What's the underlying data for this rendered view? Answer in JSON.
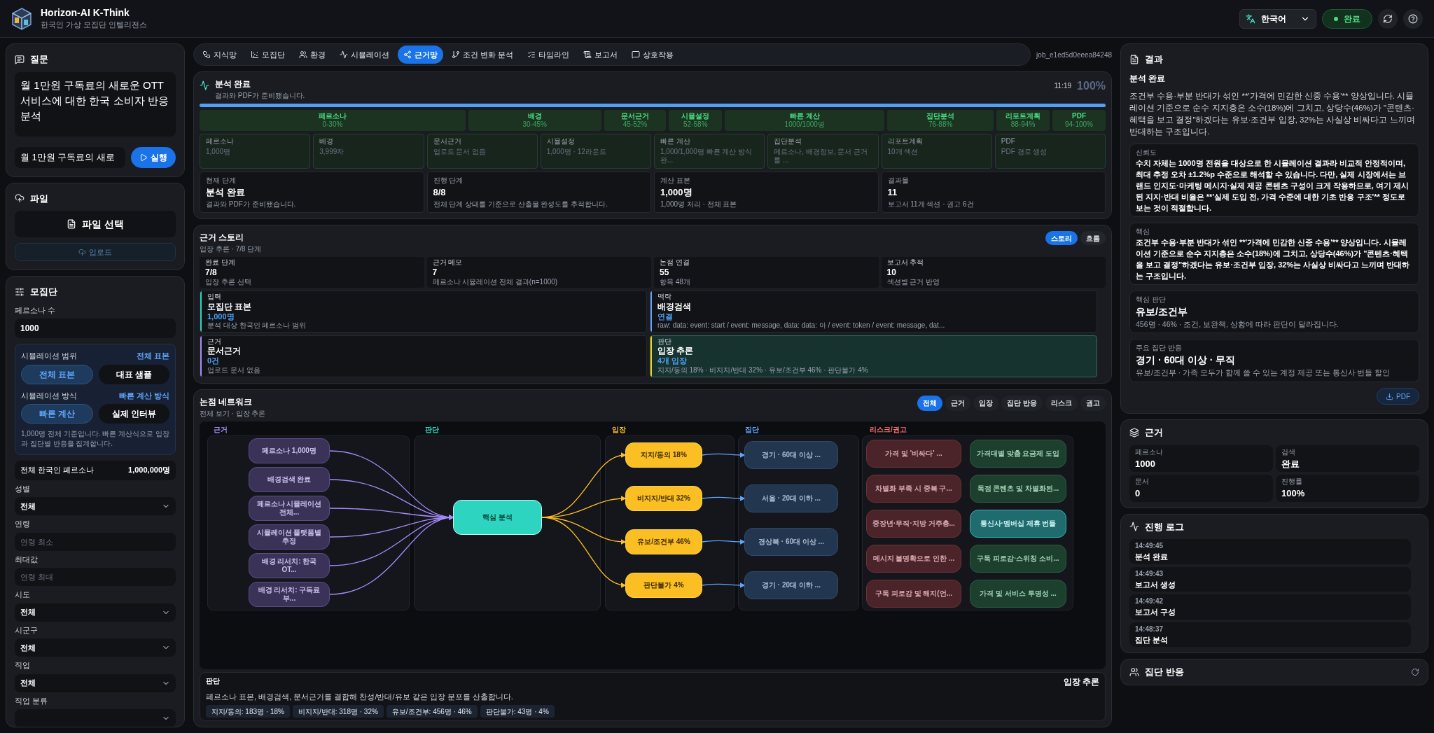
{
  "app": {
    "title": "Horizon-AI K-Think",
    "subtitle": "한국인 가상 모집단 인텔리전스"
  },
  "header": {
    "language": "한국어",
    "status": "완료"
  },
  "question": {
    "title": "질문",
    "text": "월 1만원 구독료의 새로운 OTT 서비스에 대한 한국 소비자 반응 분석",
    "input_value": "월 1만원 구독료의 새로",
    "run_label": "실행"
  },
  "file": {
    "title": "파일",
    "select_label": "파일 선택",
    "upload_label": "업로드",
    "upload_disabled": true
  },
  "population": {
    "title": "모집단",
    "count_label": "페르소나 수",
    "count_value": "1000",
    "scope": {
      "label": "시뮬레이션 범위",
      "value": "전체 표본",
      "options": [
        {
          "label": "전체 표본",
          "selected": true
        },
        {
          "label": "대표 샘플",
          "selected": false
        }
      ]
    },
    "method": {
      "label": "시뮬레이션 방식",
      "value": "빠른 계산 방식",
      "options": [
        {
          "label": "빠른 계산",
          "selected": true
        },
        {
          "label": "실제 인터뷰",
          "selected": false
        }
      ]
    },
    "note": "1,000명 전체 기준입니다. 빠른 계산식으로 입장과 집단별 반응을 집계합니다.",
    "total_label": "전체 한국인 페르소나",
    "total_value": "1,000,000명",
    "fields": [
      {
        "label": "성별",
        "kind": "select",
        "value": "전체"
      },
      {
        "label": "연령",
        "kind": "input",
        "placeholder": "연령 최소"
      },
      {
        "label": "최대값",
        "kind": "input",
        "placeholder": "연령 최대"
      },
      {
        "label": "시도",
        "kind": "select",
        "value": "전체"
      },
      {
        "label": "시군구",
        "kind": "select",
        "value": "전체"
      },
      {
        "label": "직업",
        "kind": "select",
        "value": "전체"
      },
      {
        "label": "직업 분류",
        "kind": "select"
      }
    ]
  },
  "tabs": [
    {
      "label": "지식망",
      "selected": false
    },
    {
      "label": "모집단",
      "selected": false
    },
    {
      "label": "환경",
      "selected": false
    },
    {
      "label": "시뮬레이션",
      "selected": false
    },
    {
      "label": "근거망",
      "selected": true
    },
    {
      "label": "조건 변화 분석",
      "selected": false
    },
    {
      "label": "타임라인",
      "selected": false
    },
    {
      "label": "보고서",
      "selected": false
    },
    {
      "label": "상호작용",
      "selected": false
    }
  ],
  "job_id": "job_e1ed5d0eeea84248",
  "analysis": {
    "title": "분석 완료",
    "subtitle": "결과와 PDF가 준비됐습니다.",
    "time": "11:19",
    "percent": "100%",
    "level": 1,
    "stages": [
      {
        "name": "페르소나",
        "range": "0-30%"
      },
      {
        "name": "배경",
        "range": "30-45%"
      },
      {
        "name": "문서근거",
        "range": "45-52%"
      },
      {
        "name": "시뮬설정",
        "range": "52-58%"
      },
      {
        "name": "빠른 계산",
        "range": "1000/1000명"
      },
      {
        "name": "집단분석",
        "range": "76-88%"
      },
      {
        "name": "리포트계획",
        "range": "88-94%"
      },
      {
        "name": "PDF",
        "range": "94-100%"
      }
    ],
    "details": [
      {
        "name": "페르소나",
        "detail": "1,000명"
      },
      {
        "name": "배경",
        "detail": "3,999자"
      },
      {
        "name": "문서근거",
        "detail": "업로드 문서 없음"
      },
      {
        "name": "시뮬설정",
        "detail": "1,000명 · 12라운드"
      },
      {
        "name": "빠른 계산",
        "detail": "1,000/1,000명 빠른 계산 방식 완..."
      },
      {
        "name": "집단분석",
        "detail": "페르소나, 배경정보, 문서 근거를 ..."
      },
      {
        "name": "리포트계획",
        "detail": "10개 섹션"
      },
      {
        "name": "PDF",
        "detail": "PDF 경로 생성"
      }
    ],
    "summary": [
      {
        "label": "현재 단계",
        "value": "분석 완료",
        "note": "결과와 PDF가 준비됐습니다."
      },
      {
        "label": "진행 단계",
        "value": "8/8",
        "note": "전체 단계 상태를 기준으로 산출물 완성도를 추적합니다."
      },
      {
        "label": "계산 표본",
        "value": "1,000명",
        "note": "1,000명 처리 · 전체 표본"
      },
      {
        "label": "결과물",
        "value": "11",
        "note": "보고서 11개 섹션 · 권고 6건"
      }
    ]
  },
  "story": {
    "title": "근거 스토리",
    "subtitle": "입장 추론 · 7/8 단계",
    "toggle": [
      {
        "label": "스토리",
        "selected": true
      },
      {
        "label": "흐름",
        "selected": false
      }
    ],
    "stats": [
      {
        "label": "완료 단계",
        "value": "7/8",
        "note": "입장 추론 선택"
      },
      {
        "label": "근거 메모",
        "value": "7",
        "note": "페르소나 시뮬레이션 전체 결과(n=1000)"
      },
      {
        "label": "논점 연결",
        "value": "55",
        "note": "항목 48개"
      },
      {
        "label": "보고서 추적",
        "value": "10",
        "note": "섹션별 근거 반영"
      }
    ],
    "steps": [
      {
        "tag": "입력",
        "title": "모집단 표본",
        "value": "1,000명",
        "desc": "분석 대상 한국인 페르소나 범위",
        "color": "#2dd4bf",
        "selected": false
      },
      {
        "tag": "맥락",
        "title": "배경검색",
        "value": "연결",
        "desc": "raw: data: event: start / event: message, data: data: 아 / event: token / event: message, dat...",
        "color": "#60a5fa",
        "selected": false
      },
      {
        "tag": "근거",
        "title": "문서근거",
        "value": "0건",
        "desc": "업로드 문서 없음",
        "color": "#a78bfa",
        "selected": false
      },
      {
        "tag": "판단",
        "title": "입장 추론",
        "value": "4개 입장",
        "desc": "지지/동의 18% · 비지지/반대 32% · 유보/조건부 46% · 판단불가 4%",
        "color": "#facc15",
        "selected": true
      }
    ]
  },
  "network": {
    "title": "논점 네트워크",
    "subtitle": "전체 보기 · 입장 추론",
    "filters": [
      {
        "label": "전체",
        "selected": true
      },
      {
        "label": "근거",
        "selected": false
      },
      {
        "label": "입장",
        "selected": false
      },
      {
        "label": "집단 반응",
        "selected": false
      },
      {
        "label": "리스크",
        "selected": false
      },
      {
        "label": "권고",
        "selected": false
      }
    ],
    "lanes": [
      "근거",
      "판단",
      "입장",
      "집단",
      "리스크/권고"
    ],
    "evidence_nodes": [
      "페르소나 1,000명",
      "배경검색 완료",
      "페르소나 시뮬레이션 전체...",
      "시뮬레이션 플랫폼별 추정",
      "배경 리서치: 한국 OT...",
      "배경 리서치: 구독료 부..."
    ],
    "core_node": "핵심 분석",
    "stance_nodes": [
      "지지/동의 18%",
      "비지지/반대 32%",
      "유보/조건부 46%",
      "판단불가 4%"
    ],
    "group_nodes": [
      "경기 · 60대 이상 ...",
      "서울 · 20대 이하 ...",
      "경상북 · 60대 이상 ...",
      "경기 · 20대 이하 ..."
    ],
    "risk_nodes": [
      "가격 및 '비싸다' ...",
      "차별화 부족 시 중복 구...",
      "중장년·무직·지방 거주층...",
      "메시지 불명확으로 인한 ...",
      "구독 피로감 및 해지(언..."
    ],
    "advice_nodes": [
      {
        "label": "가격대별 맞춤 요금제 도입",
        "highlighted": false
      },
      {
        "label": "독점 콘텐츠 및 차별화된...",
        "highlighted": false
      },
      {
        "label": "통신사·멤버십 제휴 번들",
        "highlighted": true
      },
      {
        "label": "구독 피로감·스위칭 소비...",
        "highlighted": false
      },
      {
        "label": "가격 및 서비스 투명성 ...",
        "highlighted": false
      }
    ],
    "footer": {
      "tag": "판단",
      "text": "페르소나 표본, 배경검색, 문서근거를 결합해 찬성/반대/유보 같은 입장 분포를 산출합니다.",
      "title": "입장 추론",
      "chips": [
        "지지/동의: 183명 · 18%",
        "비지지/반대: 318명 · 32%",
        "유보/조건부: 456명 · 46%",
        "판단불가: 43명 · 4%"
      ]
    }
  },
  "result": {
    "title": "결과",
    "heading": "분석 완료",
    "summary": "조건부 수용·부분 반대가 섞인 **'가격에 민감한 신중 수용'** 양상입니다. 시뮬레이션 기준으로 순수 지지층은 소수(18%)에 그치고, 상당수(46%)가 \"콘텐츠·혜택을 보고 결정\"하겠다는 유보·조건부 입장, 32%는 사실상 비싸다고 느끼며 반대하는 구조입니다.",
    "blocks": [
      {
        "kind": "text",
        "label": "신뢰도",
        "text": "수치 자체는 1000명 전원을 대상으로 한 시뮬레이션 결과라 비교적 안정적이며, 최대 추정 오차 ±1.2%p 수준으로 해석할 수 있습니다. 다만, 실제 시장에서는 브랜드 인지도·마케팅 메시지·실제 제공 콘텐츠 구성이 크게 작용하므로, 여기 제시된 지지·반대 비율은 **'실제 도입 전, 가격 수준에 대한 기초 반응 구조'** 정도로 보는 것이 적절합니다."
      },
      {
        "kind": "text",
        "label": "핵심",
        "text": "조건부 수용·부분 반대가 섞인 **'가격에 민감한 신중 수용'** 양상입니다. 시뮬레이션 기준으로 순수 지지층은 소수(18%)에 그치고, 상당수(46%)가 \"콘텐츠·혜택을 보고 결정\"하겠다는 유보·조건부 입장, 32%는 사실상 비싸다고 느끼며 반대하는 구조입니다."
      },
      {
        "kind": "stat",
        "label": "핵심 판단",
        "title": "유보/조건부",
        "text": "456명 · 46% · 조건, 보완책, 상황에 따라 판단이 달라집니다."
      },
      {
        "kind": "stat",
        "label": "주요 집단 반응",
        "title": "경기 · 60대 이상 · 무직",
        "text": "유보/조건부 · 가족 모두가 함께 쓸 수 있는 계정 제공 또는 통신사 번들 할인"
      }
    ],
    "pdf_label": "PDF"
  },
  "evidence": {
    "title": "근거",
    "items": [
      {
        "label": "페르소나",
        "value": "1000"
      },
      {
        "label": "검색",
        "value": "완료"
      },
      {
        "label": "문서",
        "value": "0"
      },
      {
        "label": "진행률",
        "value": "100%"
      }
    ]
  },
  "log": {
    "title": "진행 로그",
    "entries": [
      {
        "time": "14:49:45",
        "text": "분석 완료"
      },
      {
        "time": "14:49:43",
        "text": "보고서 생성"
      },
      {
        "time": "14:49:42",
        "text": "보고서 구성"
      },
      {
        "time": "14:48:37",
        "text": "집단 분석"
      }
    ]
  },
  "groups": {
    "title": "집단 반응"
  }
}
